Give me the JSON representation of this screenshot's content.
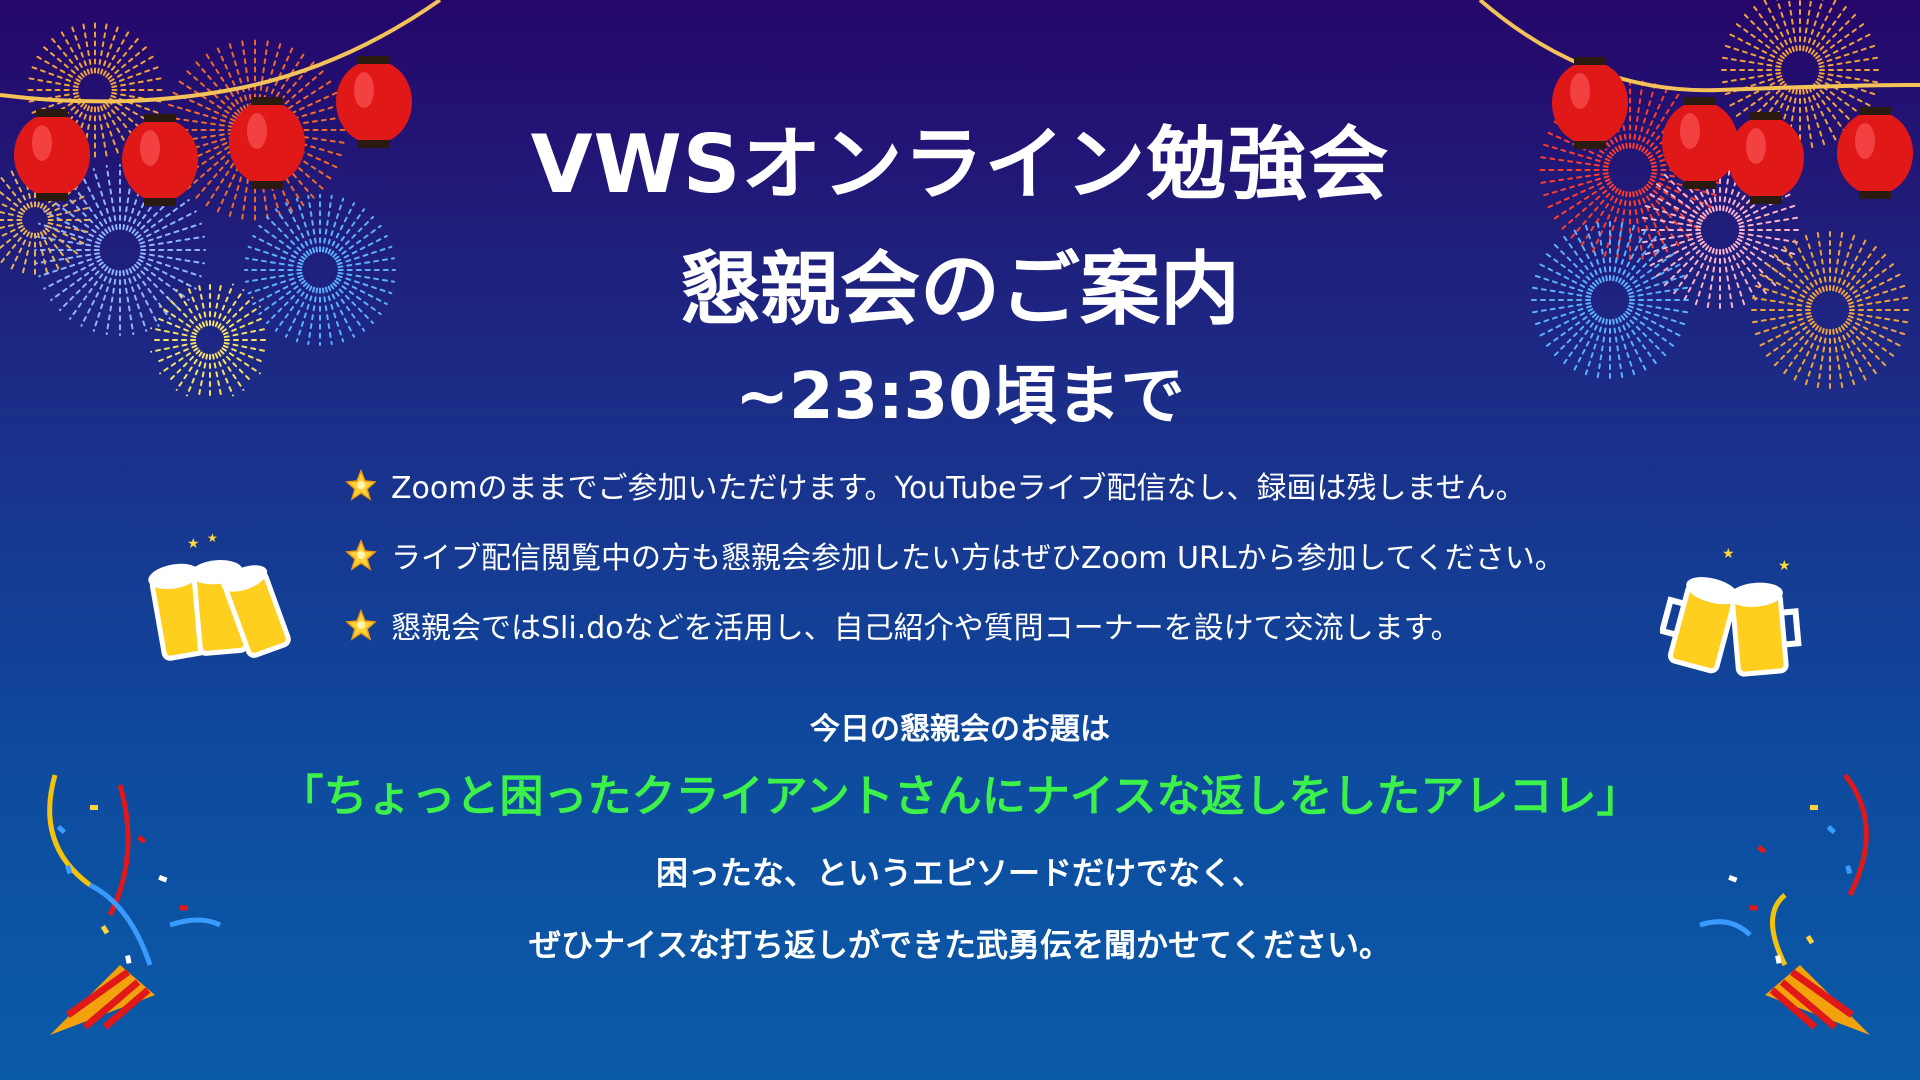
{
  "slide": {
    "title_line1": "VWSオンライン勉強会",
    "title_line2": "懇親会のご案内",
    "time": "~23:30頃まで",
    "bullets": [
      {
        "icon": "sparkle-star-icon",
        "text": "Zoomのままでご参加いただけます。YouTubeライブ配信なし、録画は残しません。"
      },
      {
        "icon": "sparkle-star-icon",
        "text": "ライブ配信閲覧中の方も懇親会参加したい方はぜひZoom URLから参加してください。"
      },
      {
        "icon": "sparkle-star-icon",
        "text": "懇親会ではSli.doなどを活用し、自己紹介や質問コーナーを設けて交流します。"
      }
    ],
    "topic_heading": "今日の懇親会のお題は",
    "topic": "「ちょっと困ったクライアントさんにナイスな返しをしたアレコレ」",
    "description_line1": "困ったな、というエピソードだけでなく、",
    "description_line2": "ぜひナイスな打ち返しができた武勇伝を聞かせてください。"
  },
  "decorations": [
    "fireworks-icon",
    "paper-lantern-icon",
    "beer-toast-icon",
    "party-popper-icon",
    "confetti"
  ],
  "colors": {
    "background_top": "#25076a",
    "background_bottom": "#0a5ba8",
    "topic_green": "#3cf24a",
    "lantern_red": "#e01818",
    "text_white": "#ffffff"
  }
}
